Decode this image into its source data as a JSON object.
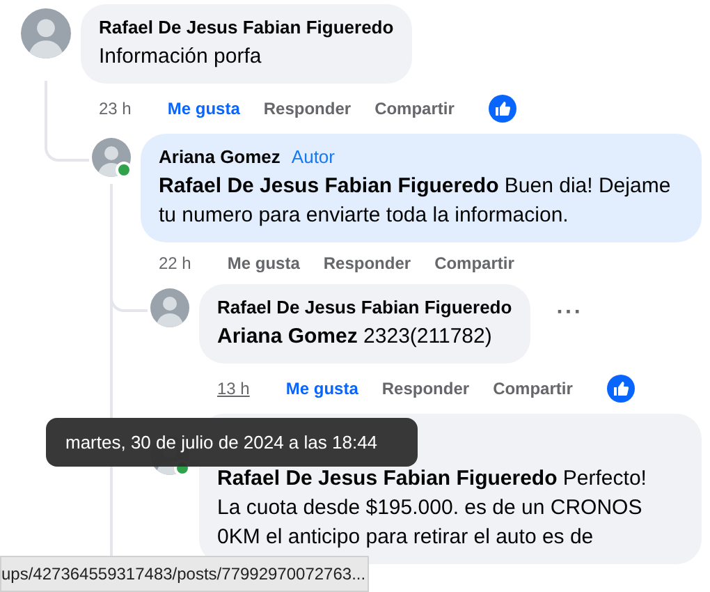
{
  "comments": [
    {
      "author": "Rafael De Jesus Fabian Figueredo",
      "text": "Información porfa",
      "time": "23 h",
      "time_hovered": false,
      "online": false,
      "actions": [
        "Me gusta",
        "Responder",
        "Compartir"
      ],
      "liked": true,
      "has_reaction": true,
      "highlighted": false,
      "children": [
        {
          "author": "Ariana Gomez",
          "badge": "Autor",
          "mention": "Rafael De Jesus Fabian Figueredo",
          "text": "Buen dia! Dejame tu numero para enviarte toda la informacion.",
          "time": "22 h",
          "time_hovered": false,
          "online": true,
          "actions": [
            "Me gusta",
            "Responder",
            "Compartir"
          ],
          "liked": false,
          "has_reaction": false,
          "highlighted": true,
          "children": [
            {
              "author": "Rafael De Jesus Fabian Figueredo",
              "mention": "Ariana Gomez",
              "text": "2323(211782)",
              "time": "13 h",
              "time_hovered": true,
              "online": false,
              "actions": [
                "Me gusta",
                "Responder",
                "Compartir"
              ],
              "liked": true,
              "has_reaction": true,
              "more_button": "···",
              "highlighted": false
            },
            {
              "mention": "Rafael De Jesus Fabian Figueredo",
              "text": "Perfecto! La cuota desde $195.000. es de un CRONOS 0KM el anticipo para retirar el auto es de",
              "online": true,
              "highlighted": false
            }
          ]
        }
      ]
    }
  ],
  "tooltip": "martes, 30 de julio de 2024 a las 18:44",
  "status_bar": {
    "url": "ups/427364559317483/posts/77992970072763..."
  }
}
